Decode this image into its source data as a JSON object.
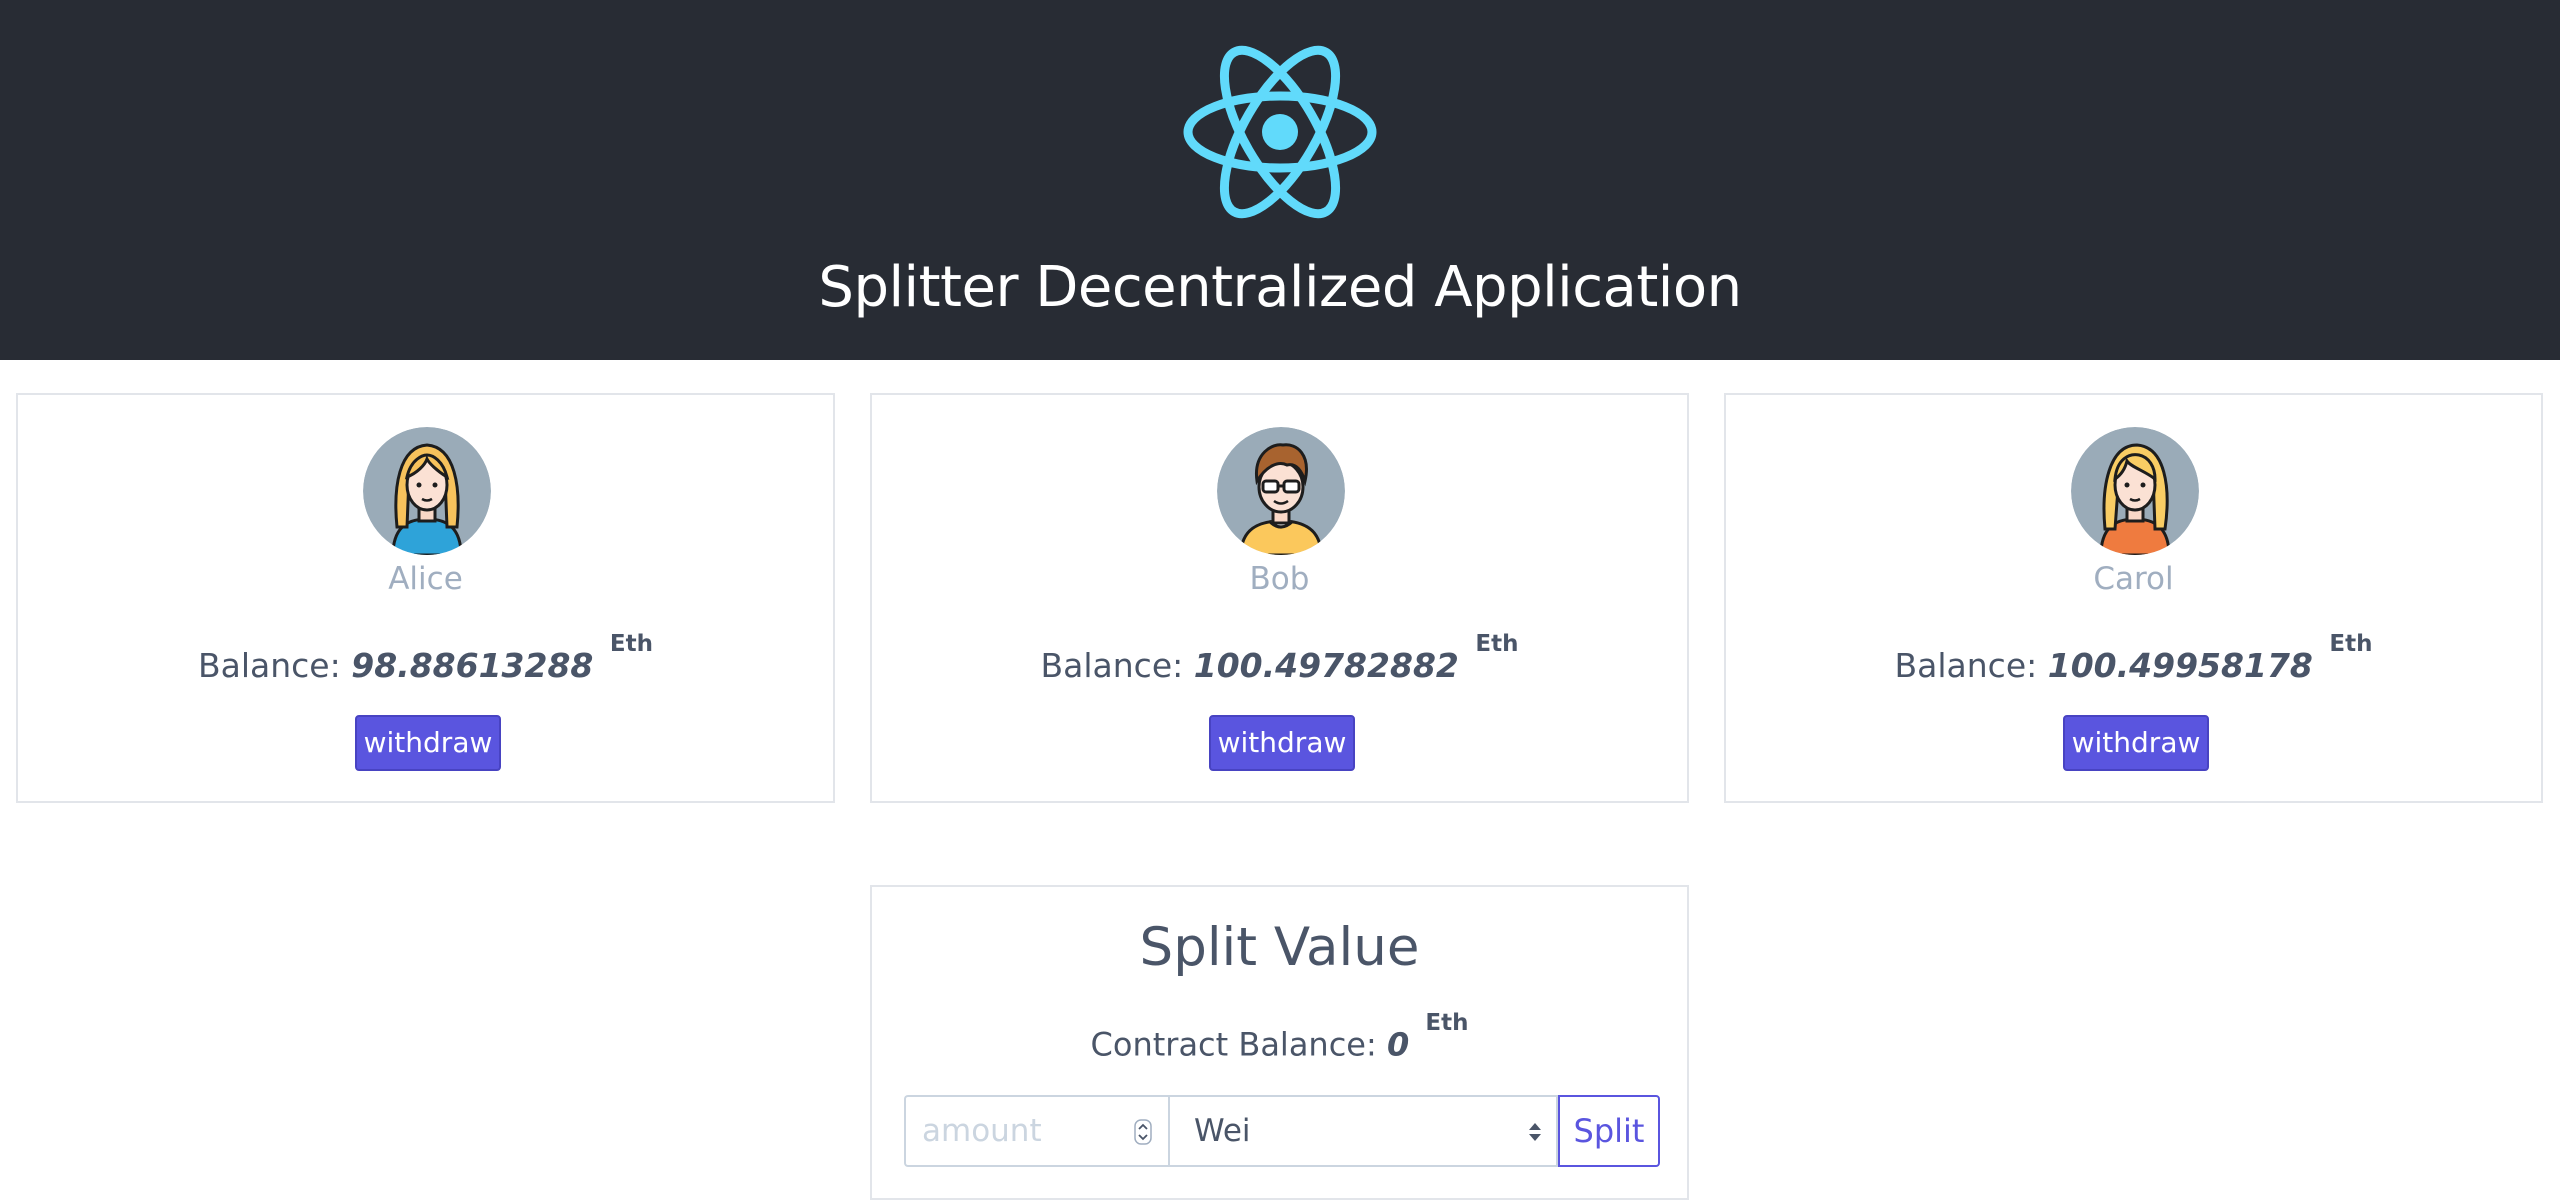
{
  "header": {
    "title": "Splitter Decentralized Application",
    "logo_icon": "react-atom-icon",
    "background": "#282c34",
    "logo_color": "#61dafb"
  },
  "users": [
    {
      "name": "Alice",
      "avatar_icon": "female-blonde-avatar-icon",
      "balance_label": "Balance:",
      "balance_value": "98.88613288",
      "unit": "Eth",
      "withdraw_label": "withdraw"
    },
    {
      "name": "Bob",
      "avatar_icon": "male-glasses-avatar-icon",
      "balance_label": "Balance:",
      "balance_value": "100.49782882",
      "unit": "Eth",
      "withdraw_label": "withdraw"
    },
    {
      "name": "Carol",
      "avatar_icon": "female-blonde-avatar-icon",
      "balance_label": "Balance:",
      "balance_value": "100.49958178",
      "unit": "Eth",
      "withdraw_label": "withdraw"
    }
  ],
  "split": {
    "title": "Split Value",
    "contract_balance_label": "Contract Balance:",
    "contract_balance_value": "0",
    "unit": "Eth",
    "amount_placeholder": "amount",
    "amount_value": "",
    "unit_selected": "Wei",
    "split_label": "Split"
  },
  "colors": {
    "accent": "#5a55df",
    "text": "#4a5568",
    "muted": "#a0aec0",
    "border": "#e2e5ea"
  }
}
